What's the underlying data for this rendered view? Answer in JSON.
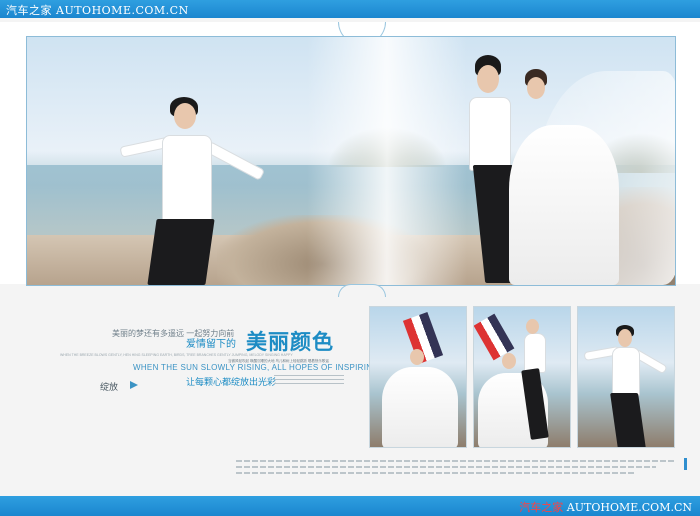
{
  "watermark_top": {
    "text": "汽车之家 AUTOHOME.COM.CN"
  },
  "watermark_bottom": {
    "cn": "汽车之家",
    "en": " AUTOHOME.COM.CN"
  },
  "text_block": {
    "line1": "美丽的梦还有多遥远 一起努力向前",
    "subtitle": "爱情留下的",
    "title": "美丽颜色",
    "small_line": "WHEN THE BREEZE BLOWS GENTLY, HEN HING SLEEPING EARTH, BIRDS, TREE BRANCHES GENTLY JUMPING, MELODY SINGING HAPPY",
    "cn_small_line": "当微风轻吹起 唤醒沉睡的大地 鸟儿和树上轻轻跳跃 唱着快乐歌谣",
    "caps_line": "WHEN THE SUN SLOWLY RISING, ALL HOPES OF INSPIRING",
    "open": "绽放",
    "heart": "让每颗心都绽放出光彩"
  },
  "colors": {
    "accent": "#1d8cc4",
    "bar": "#1b86cf",
    "watermark_red": "#ff4040"
  },
  "icons": {
    "arrow": "arrow-right-icon"
  }
}
